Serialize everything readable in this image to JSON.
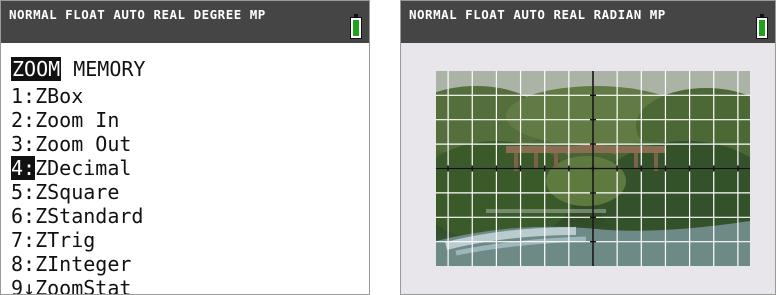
{
  "left_screen": {
    "status": "NORMAL FLOAT AUTO REAL DEGREE MP",
    "tabs": {
      "active": "ZOOM",
      "other": "MEMORY"
    },
    "items": [
      {
        "num": "1:",
        "label": "ZBox"
      },
      {
        "num": "2:",
        "label": "Zoom In"
      },
      {
        "num": "3:",
        "label": "Zoom Out"
      },
      {
        "num": "4:",
        "label": "ZDecimal",
        "selected": true
      },
      {
        "num": "5:",
        "label": "ZSquare"
      },
      {
        "num": "6:",
        "label": "ZStandard"
      },
      {
        "num": "7:",
        "label": "ZTrig"
      },
      {
        "num": "8:",
        "label": "ZInteger"
      },
      {
        "num": "9↓",
        "label": "ZoomStat"
      }
    ]
  },
  "right_screen": {
    "status": "NORMAL FLOAT AUTO REAL RADIAN MP"
  },
  "colors": {
    "status_bar": "#454545",
    "battery_green": "#1fa31f",
    "grid": "#ffffff",
    "axes": "#111111"
  }
}
